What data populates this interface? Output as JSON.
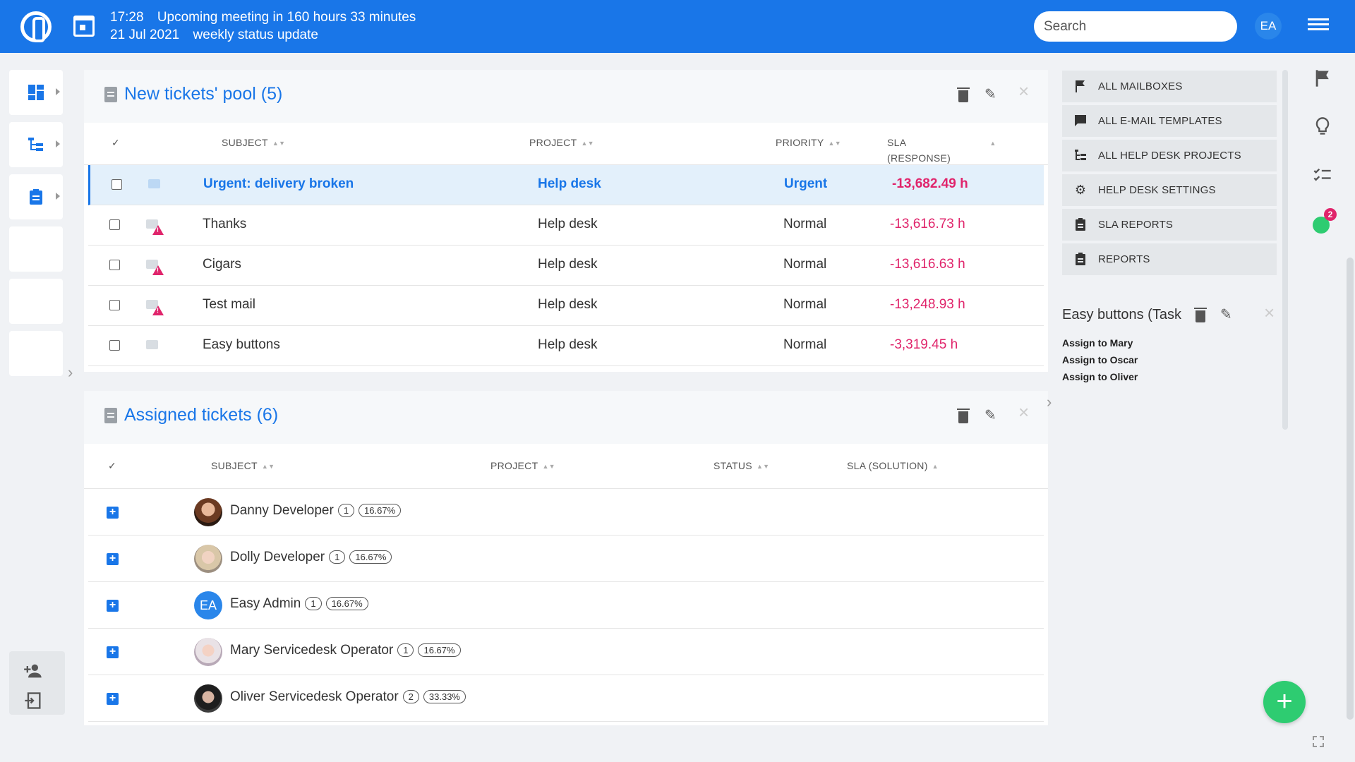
{
  "topbar": {
    "time": "17:28",
    "date": "21 Jul 2021",
    "meeting_text": "Upcoming meeting in 160 hours 33 minutes",
    "meeting_name": "weekly status update",
    "search_placeholder": "Search",
    "user_initials": "EA",
    "brand_color": "#1976e8"
  },
  "new_pool": {
    "title": "New tickets' pool (5)",
    "columns": [
      "SUBJECT",
      "PROJECT",
      "PRIORITY",
      "SLA",
      "(RESPONSE)"
    ],
    "check_header": "✓",
    "rows": [
      {
        "subject": "Urgent: delivery broken",
        "project": "Help desk",
        "priority": "Urgent",
        "sla": "-13,682.49 h"
      },
      {
        "subject": "Thanks",
        "project": "Help desk",
        "priority": "Normal",
        "sla": "-13,616.73 h"
      },
      {
        "subject": "Cigars",
        "project": "Help desk",
        "priority": "Normal",
        "sla": "-13,616.63 h"
      },
      {
        "subject": "Test mail",
        "project": "Help desk",
        "priority": "Normal",
        "sla": "-13,248.93 h"
      },
      {
        "subject": "Easy buttons",
        "project": "Help desk",
        "priority": "Normal",
        "sla": "-3,319.45 h"
      }
    ]
  },
  "assigned": {
    "title": "Assigned tickets (6)",
    "columns": [
      "SUBJECT",
      "PROJECT",
      "STATUS",
      "SLA (SOLUTION)"
    ],
    "check_header": "✓",
    "users": [
      {
        "name": "Danny Developer",
        "count": "1",
        "percent": "16.67%"
      },
      {
        "name": "Dolly Developer",
        "count": "1",
        "percent": "16.67%"
      },
      {
        "name": "Easy Admin",
        "count": "1",
        "percent": "16.67%",
        "initials": "EA"
      },
      {
        "name": "Mary Servicedesk Operator",
        "count": "1",
        "percent": "16.67%"
      },
      {
        "name": "Oliver Servicedesk Operator",
        "count": "2",
        "percent": "33.33%"
      }
    ]
  },
  "right_menu": {
    "items": [
      {
        "label": "ALL MAILBOXES",
        "icon": "flag-icon"
      },
      {
        "label": "ALL E-MAIL TEMPLATES",
        "icon": "chat-icon"
      },
      {
        "label": "ALL HELP DESK PROJECTS",
        "icon": "tree-icon"
      },
      {
        "label": "HELP DESK SETTINGS",
        "icon": "gear-icon"
      },
      {
        "label": "SLA REPORTS",
        "icon": "clipboard-icon"
      },
      {
        "label": "REPORTS",
        "icon": "clipboard-icon"
      }
    ]
  },
  "easy_buttons": {
    "title": "Easy buttons (Task",
    "links": [
      "Assign to Mary",
      "Assign to Oscar",
      "Assign to Oliver"
    ]
  },
  "far_right": {
    "badge_count": "2"
  },
  "colors": {
    "urgent": "#1976e8",
    "sla_negative": "#e0246b",
    "fab": "#2ecc71"
  }
}
